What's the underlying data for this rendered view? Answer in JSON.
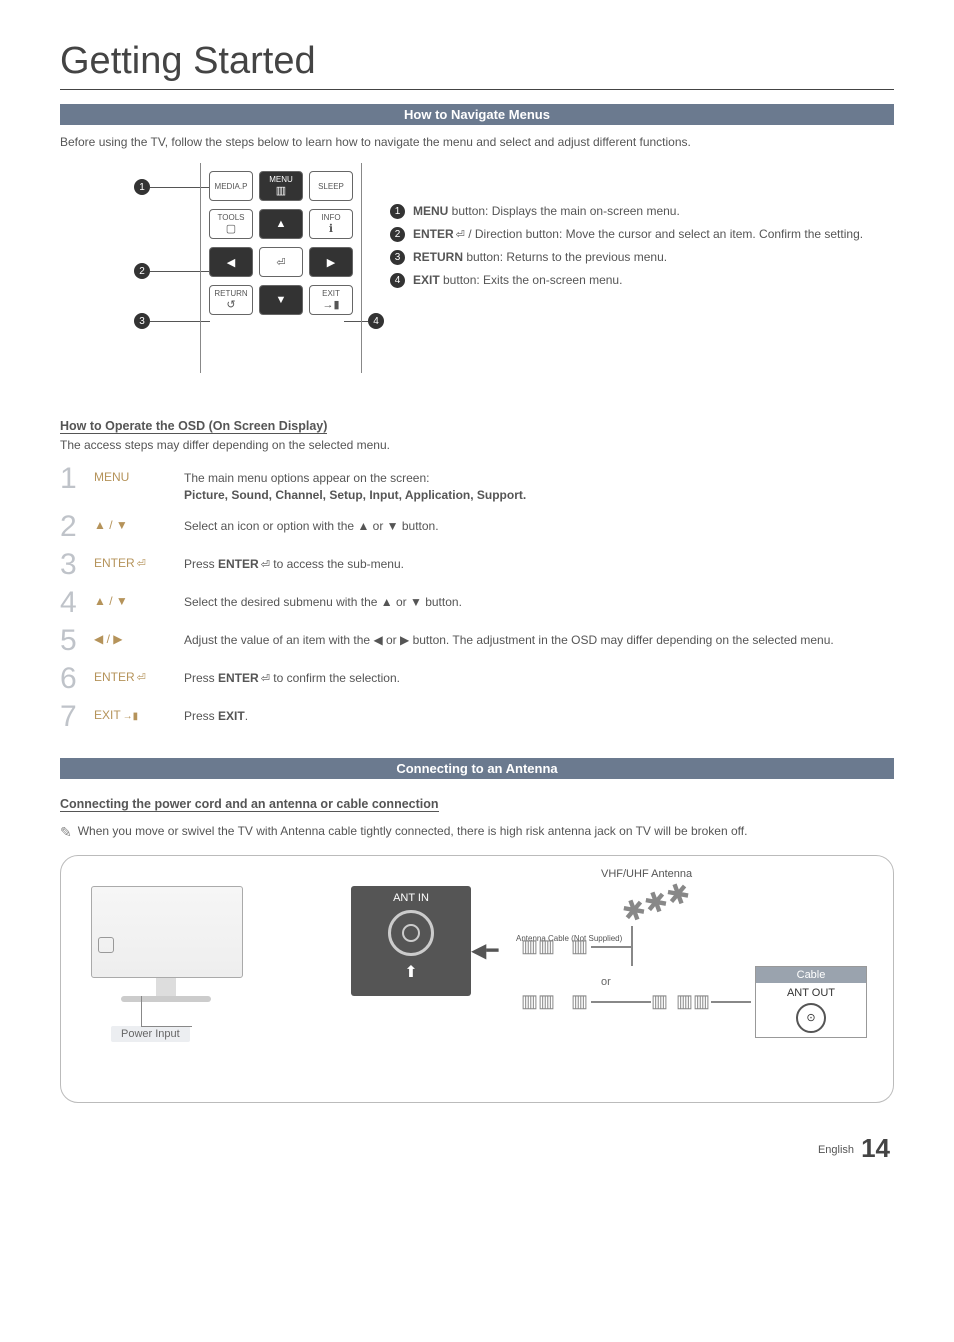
{
  "page_title": "Getting Started",
  "sections": {
    "nav_menus": {
      "bar": "How to Navigate Menus",
      "intro": "Before using the TV, follow the steps below to learn how to navigate the menu and select and adjust different functions.",
      "remote_labels": {
        "media": "MEDIA.P",
        "menu": "MENU",
        "sleep": "SLEEP",
        "tools": "TOOLS",
        "info": "INFO",
        "return": "RETURN",
        "exit": "EXIT"
      },
      "callouts": [
        "1",
        "2",
        "3",
        "4"
      ],
      "descriptions": [
        {
          "n": "1",
          "bold": "MENU",
          "text": " button: Displays the main on-screen menu."
        },
        {
          "n": "2",
          "bold": "ENTER",
          "suffix_icon": "enter",
          "text": " / Direction button: Move the cursor and select an item. Confirm the setting."
        },
        {
          "n": "3",
          "bold": "RETURN",
          "text": " button: Returns to the previous menu."
        },
        {
          "n": "4",
          "bold": "EXIT",
          "text": " button: Exits the on-screen menu."
        }
      ]
    },
    "osd": {
      "heading": "How to Operate the OSD (On Screen Display)",
      "sub": "The access steps may differ depending on the selected menu.",
      "rows": [
        {
          "n": "1",
          "key": "MENU",
          "line1": "The main menu options appear on the screen:",
          "line2": "Picture, Sound, Channel, Setup, Input, Application, Support."
        },
        {
          "n": "2",
          "key": "▲ / ▼",
          "line1": "Select an icon or option with the ▲ or ▼ button."
        },
        {
          "n": "3",
          "key": "ENTER",
          "key_icon": "enter",
          "line1_prefix": "Press ",
          "line1_bold": "ENTER",
          "line1_bold_icon": "enter",
          "line1_suffix": " to access the sub-menu."
        },
        {
          "n": "4",
          "key": "▲ / ▼",
          "line1": "Select the desired submenu with the ▲ or ▼ button."
        },
        {
          "n": "5",
          "key": "◀ / ▶",
          "line1": "Adjust the value of an item with the ◀ or ▶ button. The adjustment in the OSD may differ depending on the selected menu."
        },
        {
          "n": "6",
          "key": "ENTER",
          "key_icon": "enter",
          "line1_prefix": "Press ",
          "line1_bold": "ENTER",
          "line1_bold_icon": "enter",
          "line1_suffix": " to confirm the selection."
        },
        {
          "n": "7",
          "key": "EXIT",
          "key_icon": "exit",
          "line1_prefix": "Press ",
          "line1_bold": "EXIT",
          "line1_suffix": "."
        }
      ]
    },
    "antenna": {
      "bar": "Connecting to an Antenna",
      "heading": "Connecting the power cord and an antenna or cable connection",
      "note": "When you move or swivel the TV with Antenna cable tightly connected, there is high risk antenna jack on TV will be broken off.",
      "labels": {
        "power": "Power Input",
        "ant_in": "ANT IN",
        "vhf": "VHF/UHF Antenna",
        "cable_note": "Antenna Cable (Not Supplied)",
        "or": "or",
        "cable": "Cable",
        "ant_out": "ANT OUT"
      }
    }
  },
  "footer": {
    "lang": "English",
    "page": "14"
  }
}
